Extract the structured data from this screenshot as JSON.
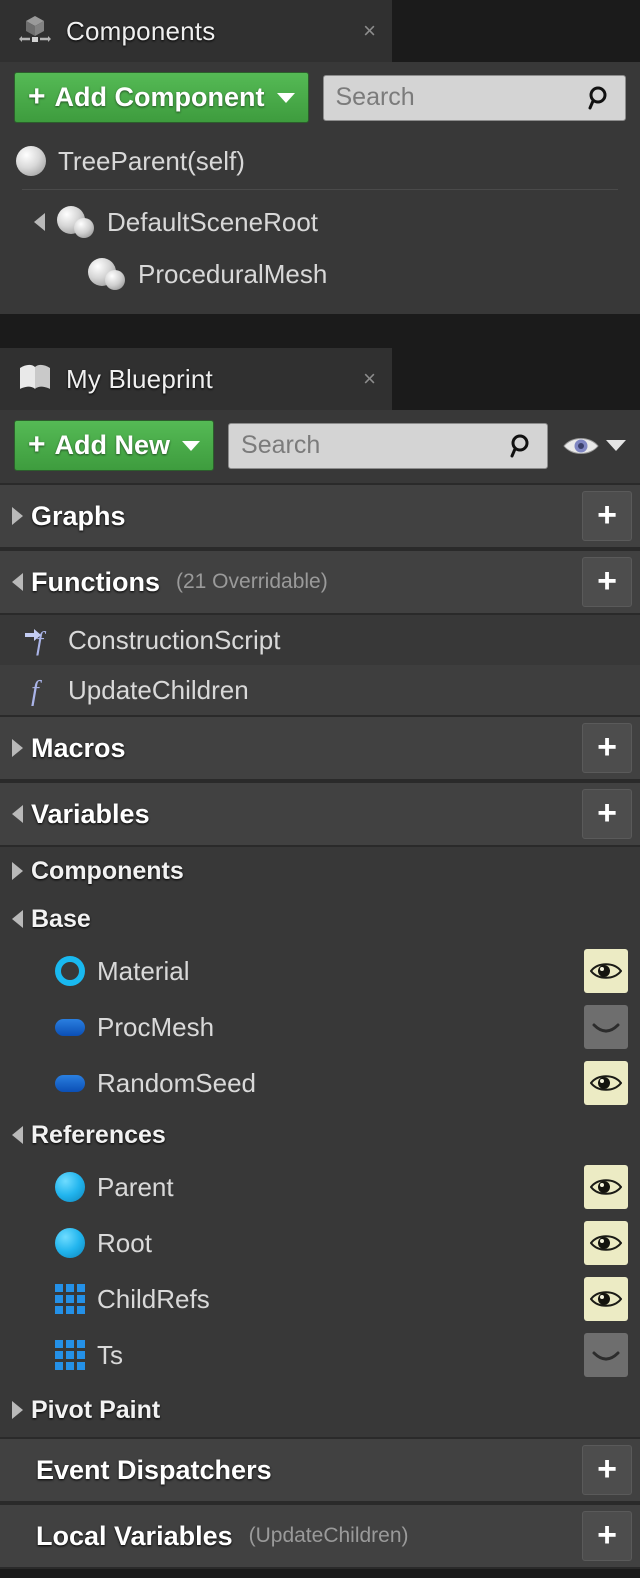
{
  "components_panel": {
    "tab": {
      "title": "Components",
      "icon": "components-gizmo-icon",
      "close": "×"
    },
    "toolbar": {
      "add_label": "Add Component",
      "add_plus": "+",
      "search_placeholder": "Search"
    },
    "tree": [
      {
        "label": "TreeParent(self)",
        "icon": "sphere-icon",
        "indent": 0,
        "expander": "none"
      },
      {
        "label": "DefaultSceneRoot",
        "icon": "scene-root-icon",
        "indent": 1,
        "expander": "open"
      },
      {
        "label": "ProceduralMesh",
        "icon": "procedural-mesh-icon",
        "indent": 2,
        "expander": "none"
      }
    ]
  },
  "my_blueprint_panel": {
    "tab": {
      "title": "My Blueprint",
      "icon": "book-icon",
      "close": "×"
    },
    "toolbar": {
      "add_label": "Add New",
      "add_plus": "+",
      "search_placeholder": "Search",
      "visibility_icon": "eye-open-icon"
    },
    "sections": [
      {
        "name": "graphs",
        "label": "Graphs",
        "sub": "",
        "expander": "closed",
        "add": "+"
      },
      {
        "name": "functions",
        "label": "Functions",
        "sub": "(21 Overridable)",
        "expander": "open",
        "add": "+"
      },
      {
        "name": "macros",
        "label": "Macros",
        "sub": "",
        "expander": "closed",
        "add": "+"
      },
      {
        "name": "variables",
        "label": "Variables",
        "sub": "",
        "expander": "open",
        "add": "+"
      },
      {
        "name": "event-dispatchers",
        "label": "Event Dispatchers",
        "sub": "",
        "expander": "none",
        "add": "+"
      },
      {
        "name": "local-variables",
        "label": "Local Variables",
        "sub": "(UpdateChildren)",
        "expander": "none",
        "add": "+"
      }
    ],
    "functions": [
      {
        "label": "ConstructionScript",
        "icon": "function-override-icon",
        "selected": false
      },
      {
        "label": "UpdateChildren",
        "icon": "function-icon",
        "selected": true
      }
    ],
    "variable_categories": [
      {
        "label": "Components",
        "expander": "closed",
        "variables": []
      },
      {
        "label": "Base",
        "expander": "open",
        "variables": [
          {
            "label": "Material",
            "type_icon": "object-ref-ring-icon",
            "visibility": "public"
          },
          {
            "label": "ProcMesh",
            "type_icon": "object-capsule-icon",
            "visibility": "private"
          },
          {
            "label": "RandomSeed",
            "type_icon": "object-capsule-icon",
            "visibility": "public"
          }
        ]
      },
      {
        "label": "References",
        "expander": "open",
        "variables": [
          {
            "label": "Parent",
            "type_icon": "object-ball-icon",
            "visibility": "public"
          },
          {
            "label": "Root",
            "type_icon": "object-ball-icon",
            "visibility": "public"
          },
          {
            "label": "ChildRefs",
            "type_icon": "array-grid-icon",
            "visibility": "public"
          },
          {
            "label": "Ts",
            "type_icon": "array-grid-icon",
            "visibility": "private"
          }
        ]
      },
      {
        "label": "Pivot Paint",
        "expander": "closed",
        "variables": []
      }
    ]
  },
  "colors": {
    "panel_bg": "#383838",
    "tab_bg": "#303030",
    "window_bg": "#1b1b1b",
    "category_bg": "#414141",
    "accent_green": "#45a545",
    "search_field": "#d4d4d4",
    "type_blue": "#2491e8",
    "type_cyan": "#19b9f0",
    "eye_on_bg": "#ecebc4",
    "eye_off_bg": "#6e6e6e"
  }
}
